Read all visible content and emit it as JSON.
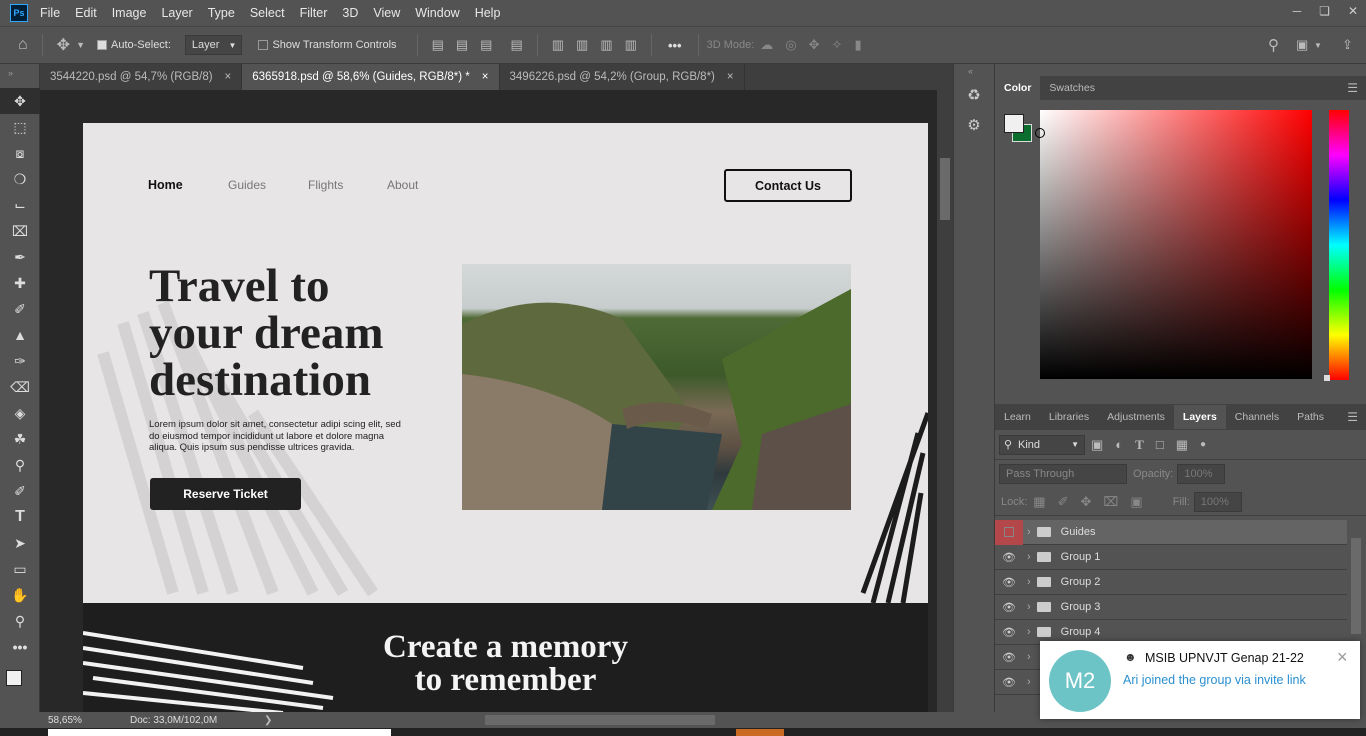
{
  "app": {
    "logo": "Ps"
  },
  "menu": [
    "File",
    "Edit",
    "Image",
    "Layer",
    "Type",
    "Select",
    "Filter",
    "3D",
    "View",
    "Window",
    "Help"
  ],
  "options": {
    "auto_select_label": "Auto-Select:",
    "auto_select_target": "Layer",
    "show_transform_label": "Show Transform Controls",
    "mode_3d_label": "3D Mode:",
    "more": "•••"
  },
  "tabs": [
    {
      "label": "3544220.psd @ 54,7% (RGB/8)",
      "close": "×"
    },
    {
      "label": "6365918.psd @ 58,6% (Guides, RGB/8*) *",
      "close": "×"
    },
    {
      "label": "3496226.psd @ 54,2% (Group, RGB/8*)",
      "close": "×"
    }
  ],
  "status": {
    "zoom": "58,65%",
    "doc": "Doc: 33,0M/102,0M"
  },
  "document": {
    "nav": {
      "home": "Home",
      "guides": "Guides",
      "flights": "Flights",
      "about": "About",
      "contact": "Contact Us"
    },
    "hero": {
      "title_line1": "Travel to",
      "title_line2": "your dream",
      "title_line3": "destination",
      "body": "Lorem ipsum dolor sit amet, consectetur adipi scing elit, sed do eiusmod tempor incididunt ut labore et dolore magna aliqua. Quis ipsum sus pendisse ultrices gravida.",
      "cta": "Reserve Ticket"
    },
    "section2": {
      "title_line1": "Create a memory",
      "title_line2": "to remember"
    }
  },
  "color_panel": {
    "tabs": [
      "Color",
      "Swatches"
    ],
    "foreground": "#f0f0f0",
    "background": "#0b6e2e",
    "hue": "#ff0000"
  },
  "layers_panel": {
    "tabs": [
      "Learn",
      "Libraries",
      "Adjustments",
      "Layers",
      "Channels",
      "Paths"
    ],
    "active_tab": "Layers",
    "filter_kind": "Kind",
    "blend_mode": "Pass Through",
    "opacity_label": "Opacity:",
    "opacity": "100%",
    "lock_label": "Lock:",
    "fill_label": "Fill:",
    "fill": "100%",
    "layers": [
      "Guides",
      "Group 1",
      "Group 2",
      "Group 3",
      "Group 4",
      "",
      ""
    ]
  },
  "notification": {
    "avatar": "M2",
    "group": "MSIB UPNVJT Genap 21-22",
    "message": "Ari joined the group via invite link",
    "close": "×"
  }
}
